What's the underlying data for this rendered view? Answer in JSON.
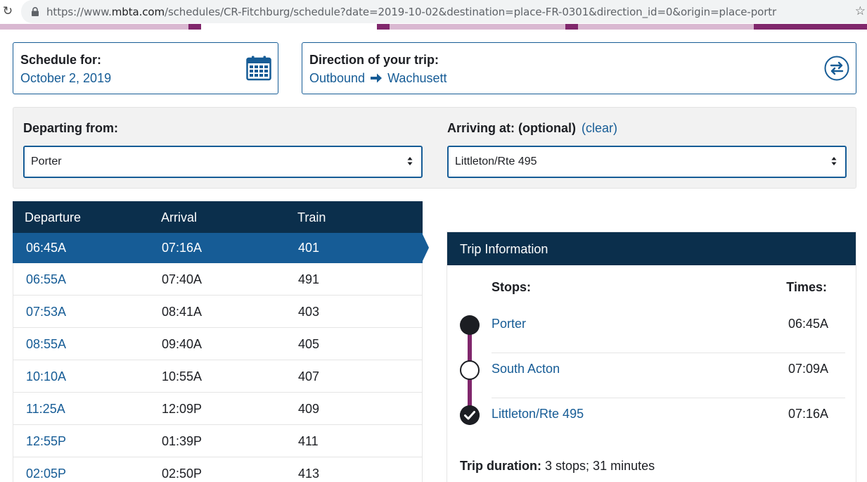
{
  "browser": {
    "url_prefix": "https://www.",
    "url_host": "mbta.com",
    "url_rest": "/schedules/CR-Fitchburg/schedule?date=2019-10-02&destination=place-FR-0301&direction_id=0&origin=place-portr"
  },
  "schedule_card": {
    "title": "Schedule for:",
    "date": "October 2, 2019"
  },
  "direction_card": {
    "title": "Direction of your trip:",
    "from": "Outbound",
    "to": "Wachusett"
  },
  "filters": {
    "departing_label": "Departing from:",
    "departing_value": "Porter",
    "arriving_label": "Arriving at: (optional)",
    "clear_link": "(clear)",
    "arriving_value": "Littleton/Rte 495"
  },
  "table": {
    "headers": [
      "Departure",
      "Arrival",
      "Train"
    ],
    "rows": [
      {
        "departure": "06:45A",
        "arrival": "07:16A",
        "train": "401"
      },
      {
        "departure": "06:55A",
        "arrival": "07:40A",
        "train": "491"
      },
      {
        "departure": "07:53A",
        "arrival": "08:41A",
        "train": "403"
      },
      {
        "departure": "08:55A",
        "arrival": "09:40A",
        "train": "405"
      },
      {
        "departure": "10:10A",
        "arrival": "10:55A",
        "train": "407"
      },
      {
        "departure": "11:25A",
        "arrival": "12:09P",
        "train": "409"
      },
      {
        "departure": "12:55P",
        "arrival": "01:39P",
        "train": "411"
      },
      {
        "departure": "02:05P",
        "arrival": "02:50P",
        "train": "413"
      }
    ]
  },
  "trip_info": {
    "title": "Trip Information",
    "stops_header": "Stops:",
    "times_header": "Times:",
    "stops": [
      {
        "name": "Porter",
        "time": "06:45A"
      },
      {
        "name": "South Acton",
        "time": "07:09A"
      },
      {
        "name": "Littleton/Rte 495",
        "time": "07:16A"
      }
    ],
    "duration_label": "Trip duration:",
    "duration_value": "3 stops; 31 minutes"
  },
  "colors": {
    "accent_blue": "#165c96",
    "header_navy": "#0b2f4c",
    "line_purple": "#80276c"
  }
}
